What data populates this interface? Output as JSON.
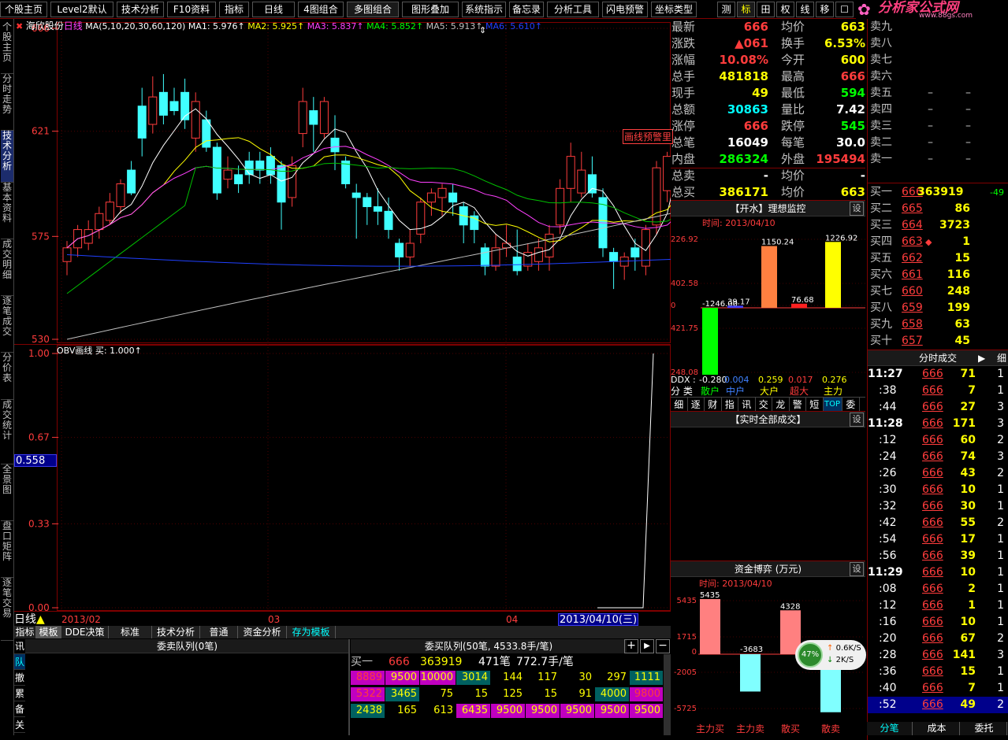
{
  "menu": [
    "个股主页",
    "Level2默认",
    "技术分析",
    "F10资料",
    "指标",
    "日线",
    "4图组合",
    "多图组合",
    "图形叠加",
    "系统指示",
    "备忘录",
    "分析工具",
    "闪电预警",
    "坐标类型"
  ],
  "menu_right": [
    "测",
    "标",
    "田",
    "权",
    "线",
    "移",
    "☐"
  ],
  "logo": {
    "title": "分析家公式网",
    "url": "www.88gs.com"
  },
  "leftnav": [
    "个股主页",
    "分时走势",
    "技术分析",
    "基本资料",
    "成交明细",
    "逐笔成交",
    "分价表",
    "成交统计",
    "全景图",
    "盘口矩阵",
    "逐笔交易"
  ],
  "chart": {
    "stock": "海欣股份",
    "period": "日线",
    "ma_legend": "MA(5,10,20,30,60,120)",
    "ma1": "MA1: 5.976↑",
    "ma2": "MA2: 5.925↑",
    "ma3": "MA3: 5.837↑",
    "ma4": "MA4: 5.852↑",
    "ma5": "MA5: 5.913↑",
    "ma6": "MA6: 5.610↑",
    "yticks": [
      "666",
      "621",
      "575",
      "530"
    ],
    "annotation": "画线预警里",
    "obv_title": "OBV画线",
    "obv_value": "买: 1.000↑",
    "obv_ticks": [
      "1.00",
      "0.67",
      "0.33",
      "0.00"
    ],
    "obv_cursor": "0.558",
    "xlabels": [
      "2013/02",
      "03",
      "04"
    ],
    "date_box": "2013/04/10(三)",
    "period_label": "日线"
  },
  "quote": {
    "rows": [
      {
        "l1": "最新",
        "v1": "666",
        "l2": "均价",
        "v2": "663"
      },
      {
        "l1": "涨跌",
        "v1": "▲061",
        "l2": "换手",
        "v2": "6.53%"
      },
      {
        "l1": "涨幅",
        "v1": "10.08%",
        "l2": "今开",
        "v2": "600"
      },
      {
        "l1": "总手",
        "v1": "481818",
        "l2": "最高",
        "v2": "666"
      },
      {
        "l1": "现手",
        "v1": "49",
        "l2": "最低",
        "v2": "594"
      },
      {
        "l1": "总额",
        "v1": "30863",
        "l2": "量比",
        "v2": "7.42"
      },
      {
        "l1": "涨停",
        "v1": "666",
        "l2": "跌停",
        "v2": "545"
      },
      {
        "l1": "总笔",
        "v1": "16049",
        "l2": "每笔",
        "v2": "30.0"
      },
      {
        "l1": "内盘",
        "v1": "286324",
        "l2": "外盘",
        "v2": "195494"
      },
      {
        "l1": "总卖",
        "v1": "-",
        "l2": "均价",
        "v2": "-"
      },
      {
        "l1": "总买",
        "v1": "386171",
        "l2": "均价",
        "v2": "663"
      }
    ]
  },
  "sell_book": [
    {
      "label": "卖九",
      "price": "",
      "vol": ""
    },
    {
      "label": "卖八",
      "price": "",
      "vol": ""
    },
    {
      "label": "卖七",
      "price": "",
      "vol": ""
    },
    {
      "label": "卖六",
      "price": "",
      "vol": ""
    },
    {
      "label": "卖五",
      "price": "–",
      "vol": "–"
    },
    {
      "label": "卖四",
      "price": "–",
      "vol": "–"
    },
    {
      "label": "卖三",
      "price": "–",
      "vol": "–"
    },
    {
      "label": "卖二",
      "price": "–",
      "vol": "–"
    },
    {
      "label": "卖一",
      "price": "–",
      "vol": "–"
    }
  ],
  "buy_book": [
    {
      "label": "买一",
      "price": "666",
      "vol": "363919",
      "chg": "-49"
    },
    {
      "label": "买二",
      "price": "665",
      "vol": "86",
      "chg": ""
    },
    {
      "label": "买三",
      "price": "664",
      "vol": "3723",
      "chg": ""
    },
    {
      "label": "买四",
      "price": "663",
      "vol": "1",
      "chg": ""
    },
    {
      "label": "买五",
      "price": "662",
      "vol": "15",
      "chg": ""
    },
    {
      "label": "买六",
      "price": "661",
      "vol": "116",
      "chg": ""
    },
    {
      "label": "买七",
      "price": "660",
      "vol": "248",
      "chg": ""
    },
    {
      "label": "买八",
      "price": "659",
      "vol": "199",
      "chg": ""
    },
    {
      "label": "买九",
      "price": "658",
      "vol": "63",
      "chg": ""
    },
    {
      "label": "买十",
      "price": "657",
      "vol": "45",
      "chg": ""
    }
  ],
  "monitor": {
    "title": "【开水】理想监控",
    "set": "设",
    "time": "时间: 2013/04/10",
    "yticks": [
      "226.92",
      "402.58",
      "0",
      "421.75",
      "248.08"
    ],
    "bars": [
      {
        "label": "散户",
        "value": -1246.0,
        "text": "-1246.00",
        "color": "#00ff00"
      },
      {
        "label": "中户",
        "value": 39.17,
        "text": "39.17",
        "color": "#4040ff"
      },
      {
        "label": "大户",
        "value": 1150.24,
        "text": "1150.24",
        "color": "#ff8040"
      },
      {
        "label": "超大",
        "value": 76.68,
        "text": "76.68",
        "color": "#ff2020"
      },
      {
        "label": "主力",
        "value": 1226.92,
        "text": "1226.92",
        "color": "#ffff00"
      }
    ],
    "ddx_label": "DDX :",
    "ddx": [
      "-0.280",
      "0.004",
      "0.259",
      "0.017",
      "0.276"
    ],
    "cat_label": "分 类",
    "tabs": [
      "细",
      "逐",
      "财",
      "指",
      "讯",
      "交",
      "龙",
      "警",
      "短",
      "TOP",
      "委"
    ]
  },
  "alltrades": {
    "title": "【实时全部成交】",
    "set": "设"
  },
  "capital": {
    "title": "资金博弈 (万元)",
    "set": "设",
    "time": "时间: 2013/04/10",
    "yticks": [
      "5435",
      "1715",
      "0",
      "-2005",
      "-5725"
    ],
    "bars": [
      {
        "label": "主力买",
        "value": 5435,
        "text": "5435",
        "color": "#ff8080"
      },
      {
        "label": "主力卖",
        "value": -3683,
        "text": "-3683",
        "color": "#80ffff"
      },
      {
        "label": "散买",
        "value": 4328,
        "text": "4328",
        "color": "#ff8080"
      },
      {
        "label": "散卖",
        "value": -5725,
        "text": "",
        "color": "#80ffff"
      }
    ],
    "speed": {
      "pct": "47%",
      "up": "0.6K/S",
      "down": "2K/S"
    }
  },
  "ticks": {
    "title": "分时成交",
    "detail": "细",
    "rows": [
      {
        "t": "11:27",
        "p": "666",
        "v": "71",
        "n": "1"
      },
      {
        "t": ":38",
        "p": "666",
        "v": "7",
        "n": "1"
      },
      {
        "t": ":44",
        "p": "666",
        "v": "27",
        "n": "3"
      },
      {
        "t": "11:28",
        "p": "666",
        "v": "171",
        "n": "3"
      },
      {
        "t": ":12",
        "p": "666",
        "v": "60",
        "n": "2"
      },
      {
        "t": ":24",
        "p": "666",
        "v": "74",
        "n": "3"
      },
      {
        "t": ":26",
        "p": "666",
        "v": "43",
        "n": "2"
      },
      {
        "t": ":30",
        "p": "666",
        "v": "10",
        "n": "1"
      },
      {
        "t": ":32",
        "p": "666",
        "v": "30",
        "n": "1"
      },
      {
        "t": ":42",
        "p": "666",
        "v": "55",
        "n": "2"
      },
      {
        "t": ":54",
        "p": "666",
        "v": "17",
        "n": "1"
      },
      {
        "t": ":56",
        "p": "666",
        "v": "39",
        "n": "1"
      },
      {
        "t": "11:29",
        "p": "666",
        "v": "10",
        "n": "1"
      },
      {
        "t": ":08",
        "p": "666",
        "v": "2",
        "n": "1"
      },
      {
        "t": ":12",
        "p": "666",
        "v": "1",
        "n": "1"
      },
      {
        "t": ":16",
        "p": "666",
        "v": "10",
        "n": "1"
      },
      {
        "t": ":20",
        "p": "666",
        "v": "67",
        "n": "2"
      },
      {
        "t": ":28",
        "p": "666",
        "v": "141",
        "n": "3"
      },
      {
        "t": ":36",
        "p": "666",
        "v": "15",
        "n": "1"
      },
      {
        "t": ":40",
        "p": "666",
        "v": "7",
        "n": "1"
      },
      {
        "t": ":52",
        "p": "666",
        "v": "49",
        "n": "2"
      }
    ],
    "tabs": [
      "分笔",
      "成本",
      "委托"
    ]
  },
  "bottom": {
    "tabs": [
      "指标",
      "模板",
      "DDE决策",
      "标准",
      "技术分析",
      "普通",
      "资金分析",
      "存为模板"
    ],
    "side": [
      "讯",
      "队",
      "撤",
      "累",
      "备",
      "关"
    ],
    "sell_queue_title": "委卖队列(0笔)",
    "buy_queue_title": "委买队列(50笔, 4533.8手/笔)",
    "buy_head": {
      "label": "买一",
      "price": "666",
      "vol": "363919",
      "count": "471笔",
      "avg": "772.7手/笔"
    },
    "queue_rows": [
      [
        "8889",
        "9500",
        "10000",
        "3014",
        "144",
        "117",
        "30",
        "297",
        "1111"
      ],
      [
        "5322",
        "3465",
        "75",
        "15",
        "125",
        "15",
        "91",
        "4000",
        "9800"
      ],
      [
        "2438",
        "165",
        "613",
        "6435",
        "9500",
        "9500",
        "9500",
        "9500",
        "9500"
      ]
    ]
  }
}
